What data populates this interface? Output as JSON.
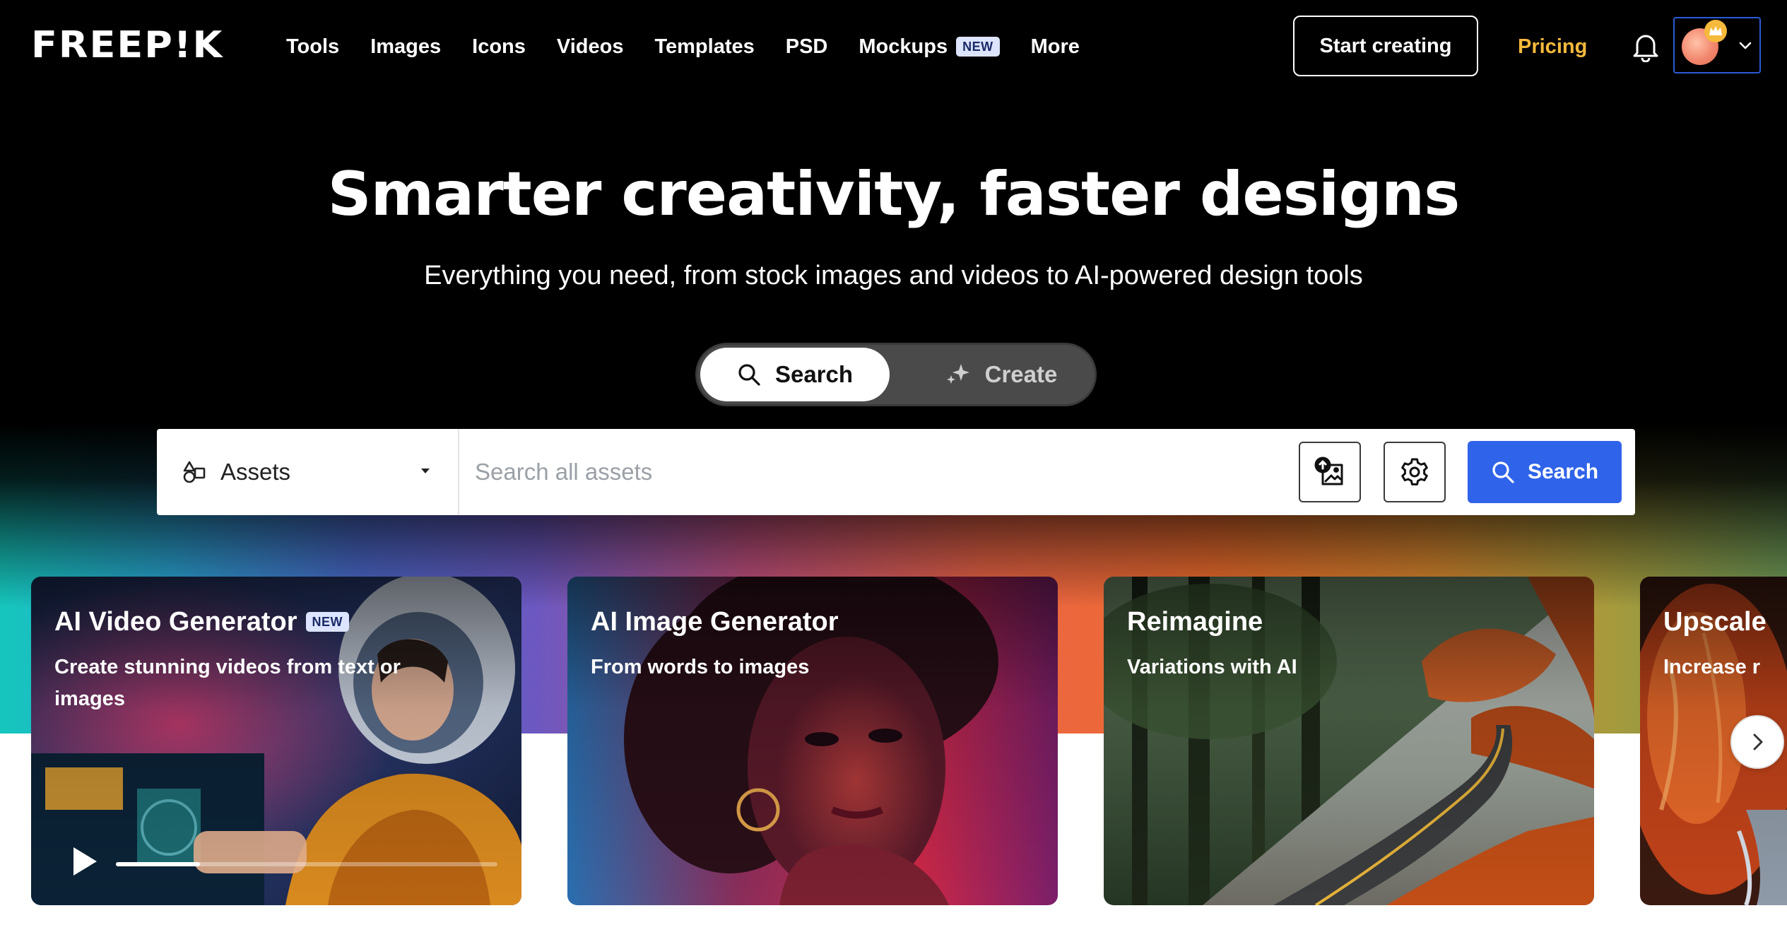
{
  "brand": {
    "logo_text": "FREEP!K"
  },
  "nav": {
    "links": [
      {
        "label": "Tools"
      },
      {
        "label": "Images"
      },
      {
        "label": "Icons"
      },
      {
        "label": "Videos"
      },
      {
        "label": "Templates"
      },
      {
        "label": "PSD"
      },
      {
        "label": "Mockups",
        "badge": "NEW"
      },
      {
        "label": "More"
      }
    ],
    "start_creating": "Start creating",
    "pricing": "Pricing",
    "icons": {
      "bell": "bell-icon",
      "avatar": "user-avatar",
      "crown": "crown-icon",
      "chevron": "chevron-down-icon"
    }
  },
  "hero": {
    "title": "Smarter creativity, faster designs",
    "subtitle": "Everything you need, from stock images and videos to AI-powered design tools"
  },
  "mode_toggle": {
    "search_label": "Search",
    "create_label": "Create",
    "active": "Search"
  },
  "search": {
    "asset_type": "Assets",
    "placeholder": "Search all assets",
    "value": "",
    "button_label": "Search",
    "icons": {
      "asset": "shapes-icon",
      "upload_image": "image-upload-icon",
      "settings": "gear-icon",
      "search": "search-icon"
    }
  },
  "cards": [
    {
      "title": "AI Video Generator",
      "badge": "NEW",
      "description": "Create stunning videos from text or images",
      "video_progress": 0.22
    },
    {
      "title": "AI Image Generator",
      "description": "From words to images"
    },
    {
      "title": "Reimagine",
      "description": "Variations with AI"
    },
    {
      "title": "Upscale",
      "description": "Increase r"
    }
  ],
  "colors": {
    "accent_blue": "#2f63e9",
    "pricing_gold": "#f5b93c",
    "hero_bg": "#000000",
    "badge_bg": "#dce4ff"
  }
}
